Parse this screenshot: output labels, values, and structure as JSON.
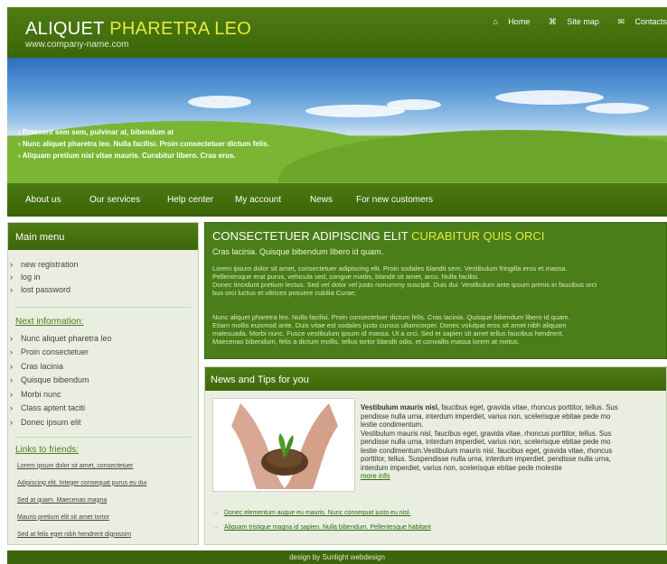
{
  "header": {
    "logo_main": "ALIQUET",
    "logo_accent": "PHARETRA LEO",
    "subtitle": "www.company-name.com",
    "links": [
      {
        "icon": "home-icon",
        "label": "Home",
        "glyph": "⌂"
      },
      {
        "icon": "sitemap-icon",
        "label": "Site map",
        "glyph": "⌘"
      },
      {
        "icon": "contacts-icon",
        "label": "Contacts",
        "glyph": "✉"
      }
    ]
  },
  "banner": {
    "bullets": [
      "Praesent sem sem, pulvinar at, bibendum at",
      "Nunc aliquet pharetra leo. Nulla facilisi. Proin consectetuer dictum felis.",
      "Aliquam pretium nisl vitae mauris. Curabitur libero. Cras eros."
    ]
  },
  "nav": [
    "About us",
    "Our services",
    "Help center",
    "My account",
    "News",
    "For new customers"
  ],
  "sidebar": {
    "title": "Main menu",
    "main_items": [
      "new registration",
      "log in",
      "lost password"
    ],
    "next_title": "Next information:",
    "next_items": [
      "Nunc aliquet pharetra leo",
      "Proin consectetuer",
      "Cras lacinia",
      "Quisque bibendum",
      "Morbi nunc",
      "Class aptent taciti",
      "Donec ipsum elit"
    ],
    "friends_title": "Links to friends:",
    "friends": [
      "Lorem ipsum dolor sit amet, consectetuer",
      "Adipiscing elit. Integer consequat purus eu dui",
      "Sed at quam. Maecenas magna",
      "Mauris pretium elit sit amet tortor",
      "Sed at felis eget nibh hendrerit dignissim"
    ]
  },
  "main": {
    "title": "CONSECTETUER ADIPISCING ELIT",
    "title_accent": "CURABITUR QUIS ORCI",
    "subtitle": "Cras lacinia. Quisque bibendum libero id quam.",
    "para1": [
      "Lorem ipsum dolor sit amet, consectetuer adipiscing elit. Proin sodales blandit sem. Vestibulum fringilla eros et massa.",
      "Pellentesque erat purus, vehicula sed, congue mattis, blandit sit amet, arcu. Nulla facilisi.",
      "Donec tincidunt pretium lectus. Sed vel dolor vel justo nonummy suscipit. Duis dui. Vestibulum ante ipsum primis in faucibus orci",
      "bus orci luctus et ultrices posuere cubilia Curae;"
    ],
    "para2": [
      "Nunc aliquet pharetra leo. Nulla facilisi. Proin consectetuer dictum felis. Cras lacinia. Quisque bibendum libero id quam.",
      "Etiam mollis euismod ante. Duis vitae est sodales justo cursus ullamcorper. Donec volutpat eros sit amet nibh aliquam",
      "malesuada. Morbi nunc. Fusce vestibulum ipsum id massa. Ut a orci. Sed et sapien sit amet tellus faucibus hendrerit.",
      "Maecenas bibendum, felis a dictum mollis, tellus tortor blandit odio, et convallis massa lorem at metus."
    ]
  },
  "news": {
    "title": "News and Tips for you",
    "lead": "Vestibulum mauris nisl,",
    "lines": [
      " faucibus eget, gravida vitae, rhoncus porttitor, tellus. Sus",
      "pendisse nulla urna, interdum imperdiet, varius non, scelerisque ebitae pede mo",
      "lestie condimentum.",
      "Vestibulum mauris nisl, faucibus eget, gravida vitae, rhoncus porttitor, tellus. Sus",
      "pendisse nulla urna, interdum imperdiet, varius non, scelerisque ebitae pede mo",
      "lestie condimentum.Vestibulum mauris nisl, faucibus eget, gravida vitae, rhoncus",
      "porttitor, tellus. Suspendisse nulla urna, interdum imperdiet. pendisse nulla urna,",
      "interdum imperdiet, varius non, scelerisque ebitae pede molestie"
    ],
    "more": "more info",
    "links": [
      "Donec elementum augue eu mauris. Nunc consequat justo eu nisl.",
      "Aliquam tristique magna id sapien. Nulla bibendum. Pellentesque habitant"
    ]
  },
  "footer": "design by Sunlight webdesign"
}
